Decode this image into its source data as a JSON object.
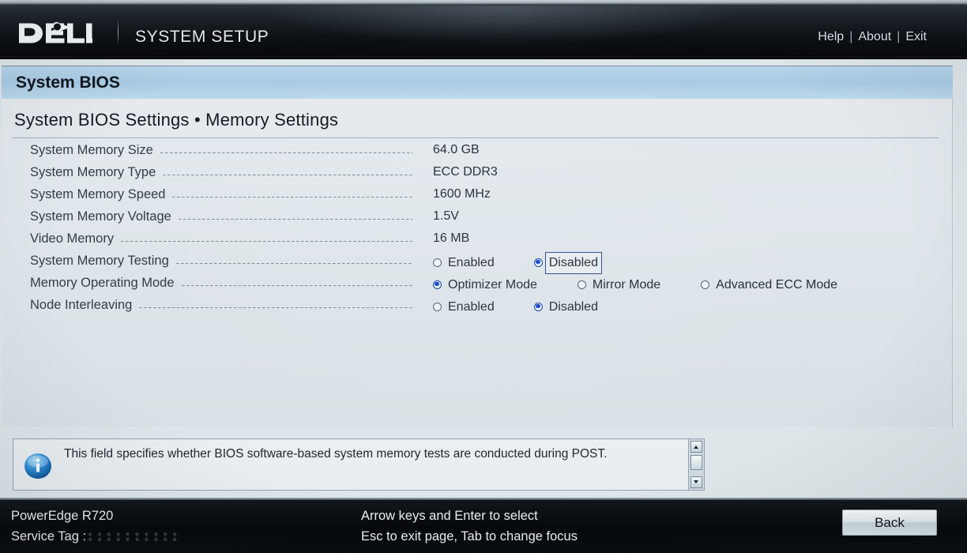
{
  "header": {
    "logo": "dell-logo",
    "title": "SYSTEM SETUP",
    "nav": [
      {
        "label": "Help"
      },
      {
        "label": "About"
      },
      {
        "label": "Exit"
      }
    ],
    "separator": "|"
  },
  "page": {
    "title": "System BIOS",
    "breadcrumb": "System BIOS Settings • Memory Settings"
  },
  "settings": [
    {
      "label": "System Memory Size",
      "type": "value",
      "value": "64.0 GB",
      "leader_width": 430
    },
    {
      "label": "System Memory Type",
      "type": "value",
      "value": "ECC DDR3",
      "leader_width": 430
    },
    {
      "label": "System Memory Speed",
      "type": "value",
      "value": "1600 MHz",
      "leader_width": 430
    },
    {
      "label": "System Memory Voltage",
      "type": "value",
      "value": "1.5V",
      "leader_width": 430
    },
    {
      "label": "Video Memory",
      "type": "value",
      "value": "16 MB",
      "leader_width": 430
    },
    {
      "label": "System Memory Testing",
      "type": "radio",
      "leader_width": 430,
      "options": [
        {
          "label": "Enabled",
          "selected": false,
          "focused": false,
          "gap": 0
        },
        {
          "label": "Disabled",
          "selected": true,
          "focused": true,
          "gap": 45
        }
      ]
    },
    {
      "label": "Memory Operating Mode",
      "type": "radio",
      "leader_width": 430,
      "options": [
        {
          "label": "Optimizer Mode",
          "selected": true,
          "focused": false,
          "gap": 0
        },
        {
          "label": "Mirror Mode",
          "selected": false,
          "focused": false,
          "gap": 46
        },
        {
          "label": "Advanced ECC Mode",
          "selected": false,
          "focused": false,
          "gap": 46
        }
      ]
    },
    {
      "label": "Node Interleaving",
      "type": "radio",
      "leader_width": 430,
      "options": [
        {
          "label": "Enabled",
          "selected": false,
          "focused": false,
          "gap": 0
        },
        {
          "label": "Disabled",
          "selected": true,
          "focused": false,
          "gap": 45
        }
      ]
    }
  ],
  "help": {
    "icon": "info-icon",
    "text": "This field specifies whether BIOS software-based system memory tests are conducted during POST.",
    "scrollbar": {
      "up": "scroll-up-arrow",
      "down": "scroll-down-arrow"
    }
  },
  "footer": {
    "model": "PowerEdge R720",
    "service_tag_label": "Service Tag :",
    "service_tag_value": "::::::::::",
    "hint_line1": "Arrow keys and Enter to select",
    "hint_line2": "Esc to exit page, Tab to change focus",
    "back_label": "Back"
  },
  "colors": {
    "accent_blue": "#1144cc",
    "titlebar_blue": "#a7cae4",
    "panel_bg": "#dde4e9",
    "header_black": "#0d1115"
  }
}
